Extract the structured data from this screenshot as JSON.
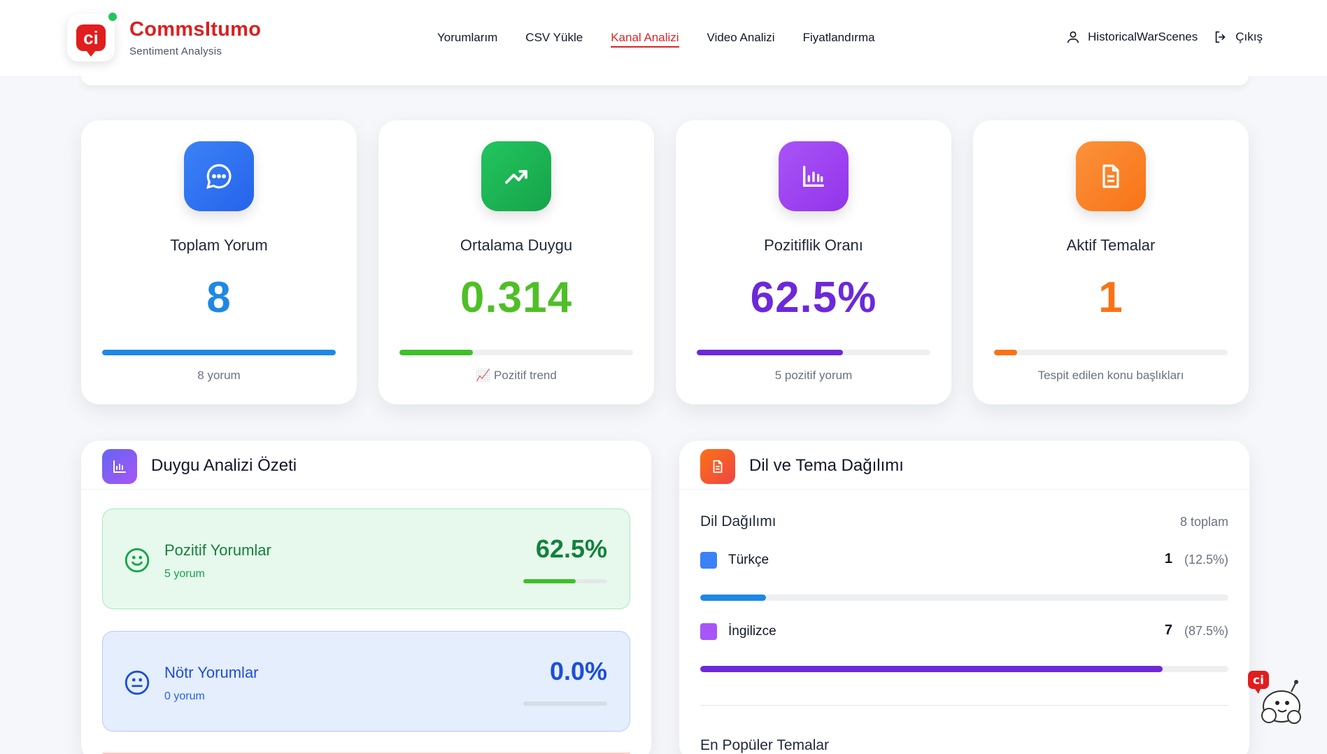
{
  "brand": {
    "name": "CommsItumo",
    "subtitle": "Sentiment Analysis",
    "logo_letter": "ci"
  },
  "nav": {
    "items": [
      {
        "label": "Yorumlarım",
        "active": false
      },
      {
        "label": "CSV Yükle",
        "active": false
      },
      {
        "label": "Kanal Analizi",
        "active": true
      },
      {
        "label": "Video Analizi",
        "active": false
      },
      {
        "label": "Fiyatlandırma",
        "active": false
      }
    ]
  },
  "user": {
    "name": "HistoricalWarScenes",
    "logout_label": "Çıkış"
  },
  "stats": [
    {
      "title": "Toplam Yorum",
      "value": "8",
      "caption": "8 yorum",
      "progress": 1.0,
      "color": "#1e88e5",
      "icon": "chat-icon",
      "icon_bg": "#2f6bea"
    },
    {
      "title": "Ortalama Duygu",
      "value": "0.314",
      "caption": "📈 Pozitif trend",
      "progress": 0.314,
      "color": "#4fbf26",
      "icon": "trending-up-icon",
      "icon_bg": "#16a34a"
    },
    {
      "title": "Pozitiflik Oranı",
      "value": "62.5%",
      "caption": "5 pozitif yorum",
      "progress": 0.625,
      "color": "#6d28d9",
      "icon": "bar-chart-icon",
      "icon_bg": "#9333ea"
    },
    {
      "title": "Aktif Temalar",
      "value": "1",
      "caption": "Tespit edilen konu başlıkları",
      "progress": 0.1,
      "color": "#f97316",
      "icon": "document-icon",
      "icon_bg": "#f97316"
    }
  ],
  "sentiment_panel": {
    "title": "Duygu Analizi Özeti",
    "items": [
      {
        "label": "Pozitif Yorumlar",
        "count": "5 yorum",
        "percent": "62.5%",
        "fraction": 0.625
      },
      {
        "label": "Nötr Yorumlar",
        "count": "0 yorum",
        "percent": "0.0%",
        "fraction": 0.0
      }
    ]
  },
  "language_panel": {
    "title": "Dil ve Tema Dağılımı",
    "distribution_title": "Dil Dağılımı",
    "total": "8 toplam",
    "languages": [
      {
        "name": "Türkçe",
        "count": "1",
        "percent": "(12.5%)",
        "fraction": 0.125,
        "color": "#3b82f6"
      },
      {
        "name": "İngilizce",
        "count": "7",
        "percent": "(87.5%)",
        "fraction": 0.875,
        "color": "#a855f7"
      }
    ],
    "themes_title": "En Popüler Temalar"
  },
  "colors": {
    "brand_red": "#dc1f1f",
    "positive": "#16a34a",
    "neutral": "#1d4ed8"
  }
}
